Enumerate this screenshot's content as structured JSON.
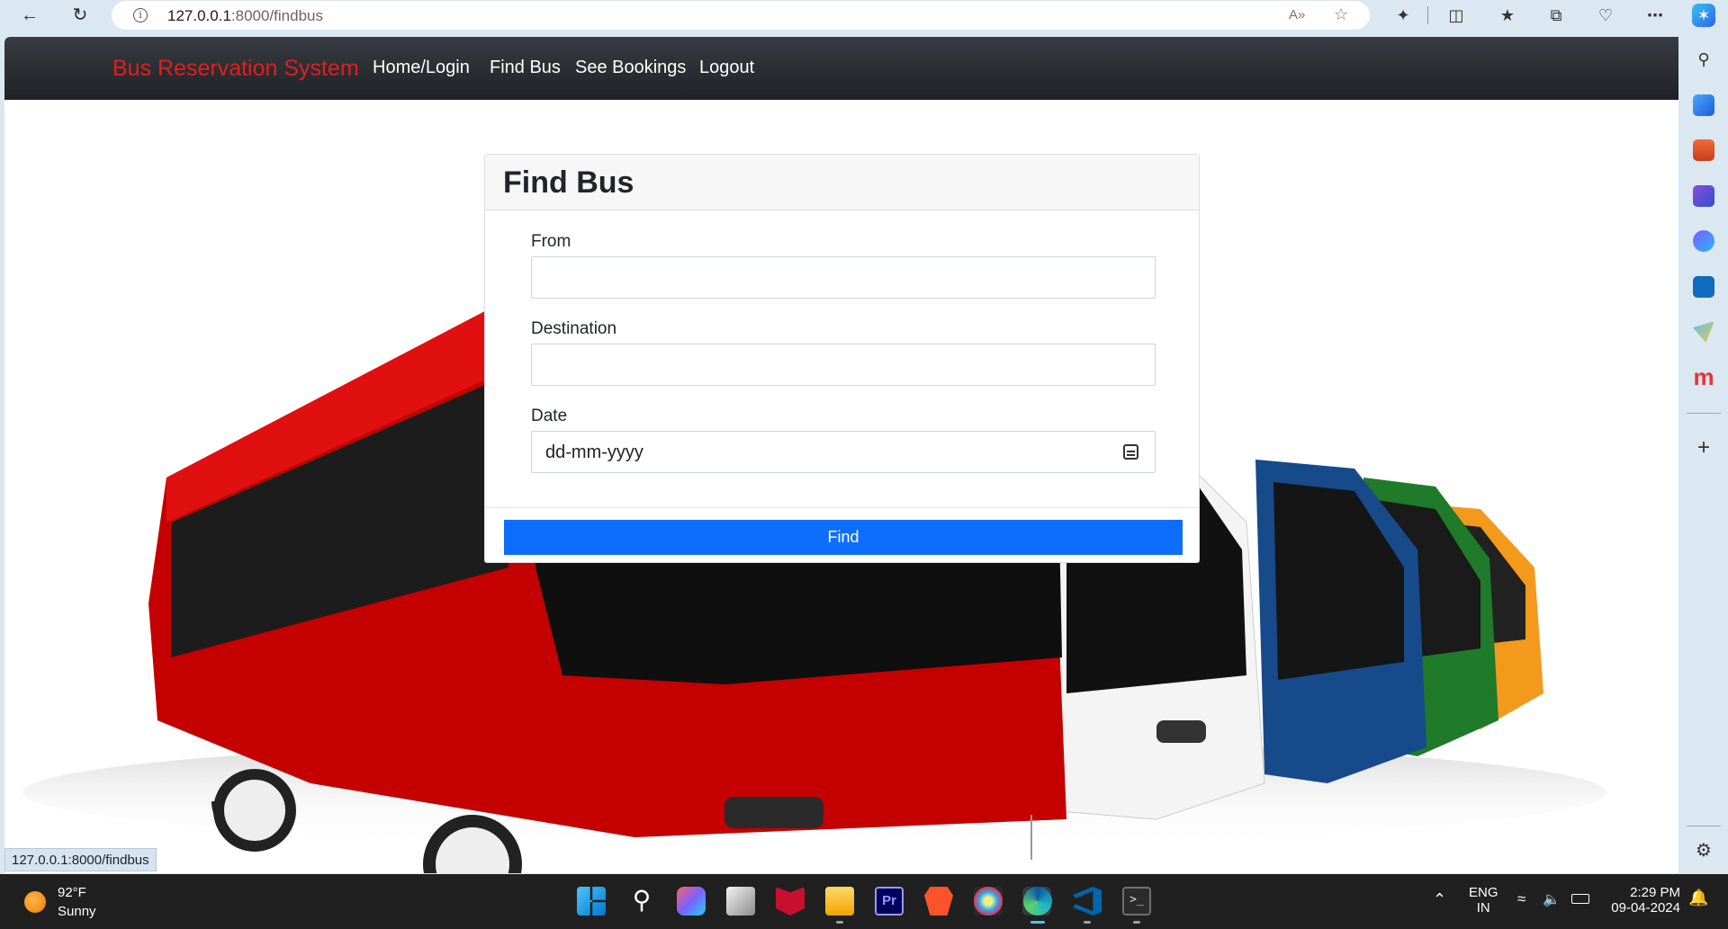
{
  "browser": {
    "url_host": "127.0.0.1",
    "url_path": ":8000/findbus",
    "read_aloud_label": "A»"
  },
  "navbar": {
    "brand": "Bus Reservation System",
    "links": [
      {
        "label": "Home/Login"
      },
      {
        "label": "Find Bus"
      },
      {
        "label": "See Bookings"
      },
      {
        "label": "Logout"
      }
    ]
  },
  "find_form": {
    "title": "Find Bus",
    "from_label": "From",
    "from_value": "",
    "destination_label": "Destination",
    "destination_value": "",
    "date_label": "Date",
    "date_placeholder": "dd-mm-yyyy",
    "submit_label": "Find"
  },
  "status_bar_url": "127.0.0.1:8000/findbus",
  "taskbar": {
    "weather_temp": "92°F",
    "weather_condition": "Sunny",
    "language_primary": "ENG",
    "language_secondary": "IN",
    "time": "2:29 PM",
    "date": "09-04-2024"
  },
  "colors": {
    "brand_red": "#e01f1f",
    "primary_blue": "#0d6efd",
    "navbar_dark": "#2b2e33"
  }
}
